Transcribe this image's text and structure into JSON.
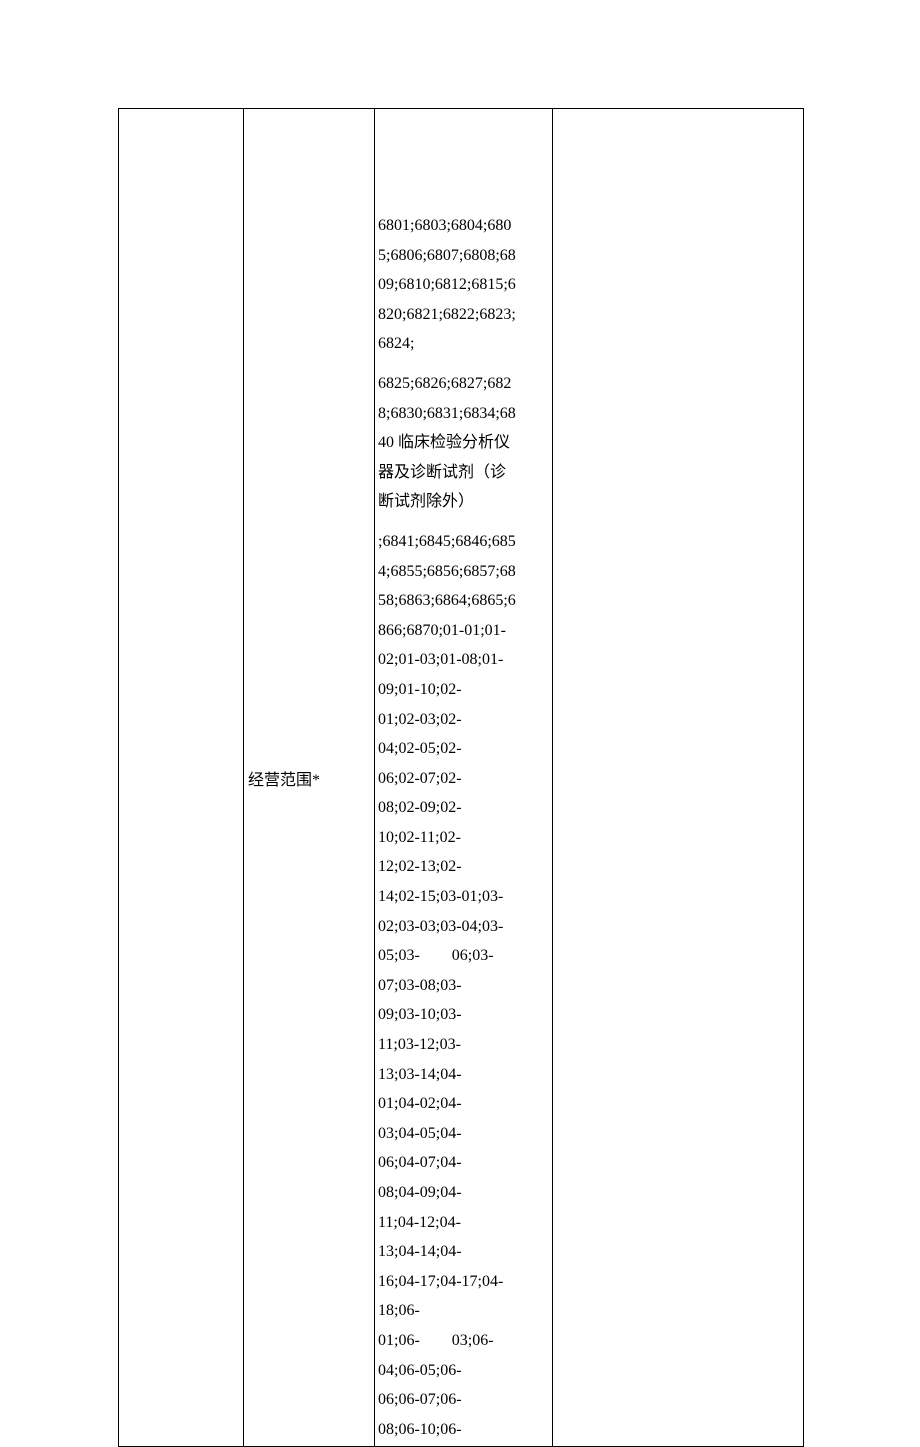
{
  "row": {
    "col1": "",
    "col2_label": "经营范围*",
    "col4": "",
    "scope": {
      "para1_lines": [
        "6801;6803;6804;680",
        "5;6806;6807;6808;68",
        "09;6810;6812;6815;6",
        "820;6821;6822;6823;",
        "6824;"
      ],
      "para2_lines": [
        "6825;6826;6827;682",
        "8;6830;6831;6834;68",
        "40 临床检验分析仪",
        "器及诊断试剂（诊",
        "断试剂除外）"
      ],
      "para3_lines": [
        ";6841;6845;6846;685",
        "4;6855;6856;6857;68",
        "58;6863;6864;6865;6",
        "866;6870;01-01;01-",
        "02;01-03;01-08;01-",
        "09;01-10;02-",
        "01;02-03;02-",
        "04;02-05;02-",
        "06;02-07;02-",
        "08;02-09;02-",
        "10;02-11;02-",
        "12;02-13;02-",
        "14;02-15;03-01;03-",
        "02;03-03;03-04;03-",
        "05;03-  06;03-",
        "07;03-08;03-",
        "09;03-10;03-",
        "11;03-12;03-",
        "13;03-14;04-",
        "01;04-02;04-",
        "03;04-05;04-",
        "06;04-07;04-",
        "08;04-09;04-",
        "11;04-12;04-",
        "13;04-14;04-",
        "16;04-17;04-17;04-",
        "18;06-",
        "01;06-  03;06-",
        "04;06-05;06-",
        "06;06-07;06-",
        "08;06-10;06-"
      ]
    }
  }
}
